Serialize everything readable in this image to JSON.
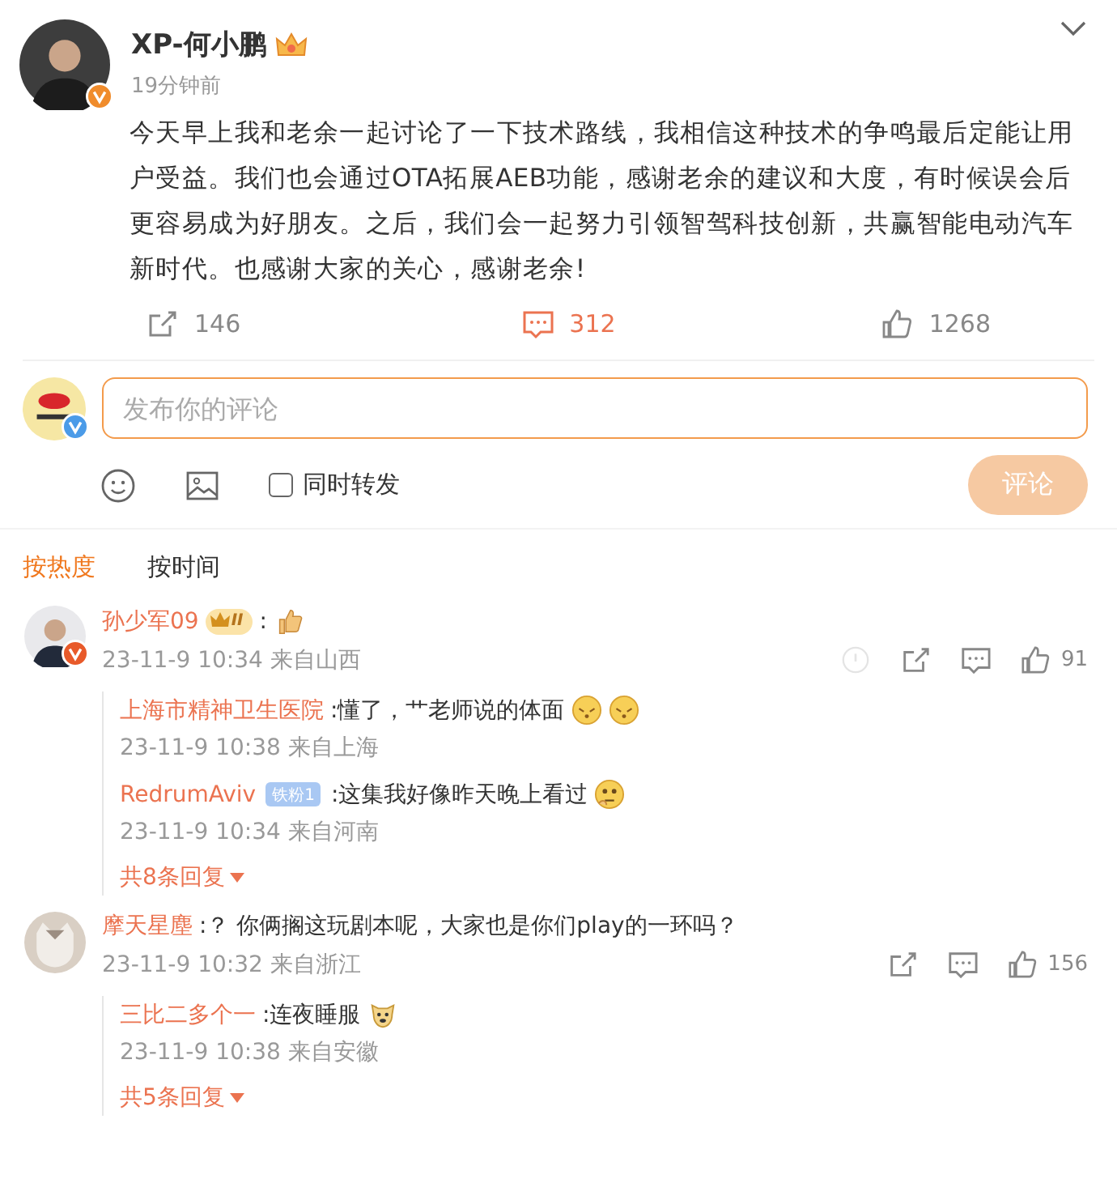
{
  "post": {
    "author": "XP-何小鹏",
    "time": "19分钟前",
    "text": "今天早上我和老余一起讨论了一下技术路线，我相信这种技术的争鸣最后定能让用户受益。我们也会通过OTA拓展AEB功能，感谢老余的建议和大度，有时候误会后更容易成为好朋友。之后，我们会一起努力引领智驾科技创新，共赢智能电动汽车新时代。也感谢大家的关心，感谢老余!",
    "actions": [
      {
        "kind": "repost",
        "count": "146",
        "selected": false
      },
      {
        "kind": "comment",
        "count": "312",
        "selected": true
      },
      {
        "kind": "like",
        "count": "1268",
        "selected": false
      }
    ]
  },
  "composer": {
    "placeholder": "发布你的评论",
    "repost_option": {
      "label": "同时转发",
      "checked": false
    },
    "submit": {
      "label": "评论",
      "disabled": true
    }
  },
  "sort_tabs": [
    {
      "label": "按热度",
      "selected": true
    },
    {
      "label": "按时间",
      "selected": false
    }
  ],
  "comments": [
    {
      "author": "孙少军09",
      "level_badge": "II",
      "text": ":",
      "emojis": [
        {
          "kind": "thumb"
        }
      ],
      "meta": "23-11-9 10:34 来自山西",
      "actions": [
        {
          "kind": "report"
        },
        {
          "kind": "share"
        },
        {
          "kind": "reply"
        },
        {
          "kind": "like",
          "count": "91"
        }
      ],
      "replies": [
        {
          "author": "上海市精神卫生医院",
          "text": ":懂了，艹老师说的体面",
          "emojis": [
            {
              "kind": "shy"
            },
            {
              "kind": "shy"
            }
          ],
          "meta": "23-11-9 10:38 来自上海"
        },
        {
          "author": "RedrumAviv",
          "fan_badge": "铁粉1",
          "text": ":这集我好像昨天晚上看过",
          "emojis": [
            {
              "kind": "think"
            }
          ],
          "meta": "23-11-9 10:34 来自河南"
        }
      ],
      "more_replies": "共8条回复"
    },
    {
      "author": "摩天星塵",
      "text": ":？ 你俩搁这玩剧本呢，大家也是你们play的一环吗？",
      "meta": "23-11-9 10:32 来自浙江",
      "actions": [
        {
          "kind": "share"
        },
        {
          "kind": "reply"
        },
        {
          "kind": "like",
          "count": "156"
        }
      ],
      "replies": [
        {
          "author": "三比二多个一",
          "text": ":连夜睡服",
          "emojis": [
            {
              "kind": "dog"
            }
          ],
          "meta": "23-11-9 10:38 来自安徽"
        }
      ],
      "more_replies": "共5条回复"
    }
  ]
}
